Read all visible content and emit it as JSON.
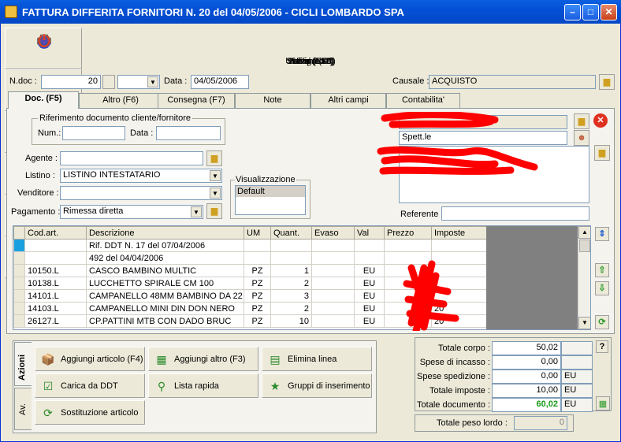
{
  "window": {
    "title": "FATTURA DIFFERITA FORNITORI N.  20  del 04/05/2006 - CICLI LOMBARDO  SPA"
  },
  "toolbar": [
    {
      "label": "Salva (F12)",
      "icon": "check-icon",
      "color": "#2fa52f",
      "glyph": "✔"
    },
    {
      "label": "Elimina",
      "icon": "delete-x-icon",
      "color": "#e03020",
      "glyph": "✖"
    },
    {
      "label": "Stampa (F9)",
      "icon": "printer-icon",
      "color": "#606060",
      "glyph": "🖶"
    },
    {
      "label": "Visual (F10)",
      "icon": "magic-wand-icon",
      "color": "#8040a0",
      "glyph": "✦"
    },
    {
      "label": "Navigatore",
      "icon": "compass-icon",
      "color": "#3050c0",
      "glyph": "◎"
    },
    {
      "label": "Uscita (ESC)",
      "icon": "exit-icon",
      "color": "#e04020",
      "glyph": "⏻"
    }
  ],
  "header": {
    "ndoc_label": "N.doc :",
    "ndoc_value": "20",
    "data_label": "Data :",
    "data_value": "04/05/2006",
    "causale_label": "Causale :",
    "causale_value": "ACQUISTO"
  },
  "tabs": [
    "Doc. (F5)",
    "Altro (F6)",
    "Consegna (F7)",
    "Note",
    "Altri campi",
    "Contabilita'"
  ],
  "riferimento": {
    "legend": "Riferimento documento cliente/fornitore",
    "num_label": "Num.:",
    "num_value": "",
    "data_label": "Data :",
    "data_value": ""
  },
  "form": {
    "agente_label": "Agente :",
    "agente_value": "",
    "listino_label": "Listino :",
    "listino_value": "LISTINO INTESTATARIO",
    "venditore_label": "Venditore :",
    "venditore_value": "",
    "pagamento_label": "Pagamento :",
    "pagamento_value": "Rimessa diretta"
  },
  "visualizzazione": {
    "legend": "Visualizzazione",
    "item": "Default"
  },
  "supplier": {
    "spett_label": "Spett.le",
    "referente_label": "Referente",
    "referente_value": ""
  },
  "grid": {
    "columns": [
      "Cod.art.",
      "Descrizione",
      "UM",
      "Quant.",
      "Evaso",
      "Val",
      "Prezzo",
      "Imposte"
    ],
    "rows": [
      [
        "",
        "Rif. DDT N. 17 del 07/04/2006",
        "",
        "",
        "",
        "",
        "",
        ""
      ],
      [
        "",
        "492 del 04/04/2006",
        "",
        "",
        "",
        "",
        "",
        ""
      ],
      [
        "10150.L",
        "CASCO BAMBINO MULTIC",
        "PZ",
        "1",
        "",
        "EU",
        "",
        ""
      ],
      [
        "10138.L",
        "LUCCHETTO SPIRALE CM 100",
        "PZ",
        "2",
        "",
        "EU",
        "",
        ""
      ],
      [
        "14101.L",
        "CAMPANELLO 48MM BAMBINO DA 22",
        "PZ",
        "3",
        "",
        "EU",
        "",
        ""
      ],
      [
        "14103.L",
        "CAMPANELLO MINI DIN DON NERO",
        "PZ",
        "2",
        "",
        "EU",
        "",
        "20"
      ],
      [
        "26127.L",
        "CP.PATTINI MTB CON DADO BRUC",
        "PZ",
        "10",
        "",
        "EU",
        "",
        "20"
      ]
    ]
  },
  "actions": {
    "tab_azioni": "Azioni",
    "tab_av": "Av.",
    "buttons": [
      {
        "label": "Aggiungi articolo (F4)",
        "icon": "add-article-icon",
        "glyph": "📦"
      },
      {
        "label": "Aggiungi altro (F3)",
        "icon": "add-other-icon",
        "glyph": "▦"
      },
      {
        "label": "Elimina linea",
        "icon": "delete-line-icon",
        "glyph": "▤"
      },
      {
        "label": "Carica da DDT",
        "icon": "load-ddt-icon",
        "glyph": "☑"
      },
      {
        "label": "Lista rapida",
        "icon": "quick-list-icon",
        "glyph": "⚲"
      },
      {
        "label": "Gruppi di inserimento",
        "icon": "groups-icon",
        "glyph": "★"
      },
      {
        "label": "Sostituzione articolo",
        "icon": "replace-article-icon",
        "glyph": "⟳"
      }
    ]
  },
  "totals": {
    "corpo_label": "Totale corpo :",
    "corpo_value": "50,02",
    "incasso_label": "Spese di incasso :",
    "incasso_value": "0,00",
    "spedizione_label": "Spese spedizione :",
    "spedizione_value": "0,00",
    "spedizione_cur": "EU",
    "imposte_label": "Totale imposte :",
    "imposte_value": "10,00",
    "imposte_cur": "EU",
    "documento_label": "Totale documento :",
    "documento_value": "60,02",
    "documento_cur": "EU",
    "peso_label": "Totale peso lordo :",
    "peso_value": "0",
    "help": "?"
  },
  "colors": {
    "accent": "#0350d6",
    "total_green": "#1a9a1a",
    "selection": "#1aa0e0"
  }
}
